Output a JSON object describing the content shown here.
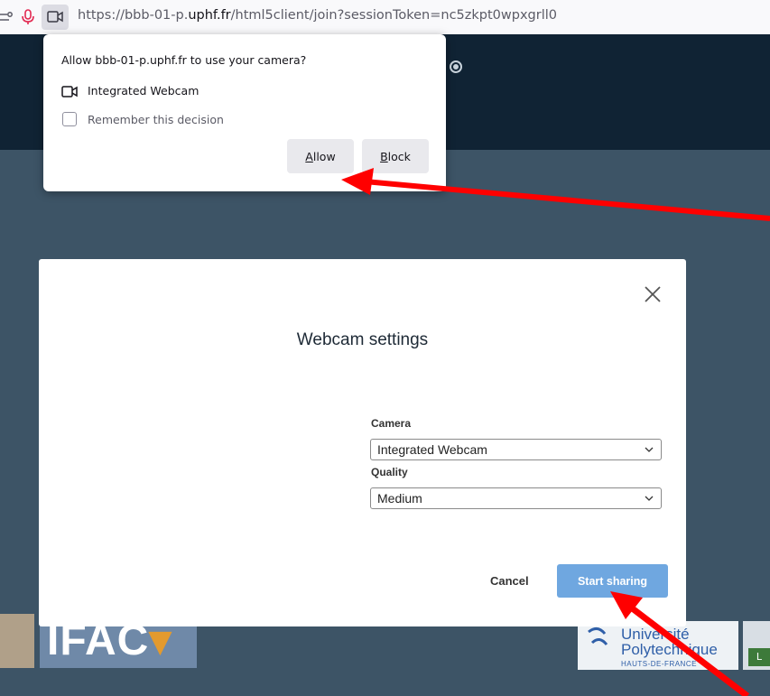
{
  "browser": {
    "url_prefix": "https://bbb-01-p.",
    "url_domain": "uphf.fr",
    "url_path": "/html5client/join?sessionToken=nc5zkpt0wpxgrll0",
    "icons": [
      "permissions-icon",
      "microphone-icon",
      "camera-icon"
    ]
  },
  "permission_popup": {
    "title": "Allow bbb-01-p.uphf.fr to use your camera?",
    "device": "Integrated Webcam",
    "remember_label": "Remember this decision",
    "remember_checked": false,
    "allow_label": "Allow",
    "block_label": "Block"
  },
  "modal": {
    "title": "Webcam settings",
    "camera_label": "Camera",
    "camera_value": "Integrated Webcam",
    "quality_label": "Quality",
    "quality_value": "Medium",
    "cancel_label": "Cancel",
    "start_label": "Start sharing"
  },
  "footer": {
    "ifac_text": "IFAC",
    "uphf_line1": "Université",
    "uphf_line2": "Polytechnique",
    "uphf_line3": "HAUTS-DE-FRANCE",
    "right_logo_letter": "L"
  },
  "colors": {
    "appbar": "#102334",
    "appbody": "#3d5466",
    "start_button": "#6fa7e0",
    "annotation_arrow": "#ff0000"
  }
}
